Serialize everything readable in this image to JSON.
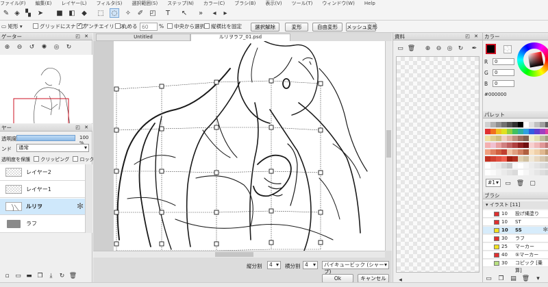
{
  "menu": [
    "ファイル(F)",
    "編集(E)",
    "レイヤー(L)",
    "フィルタ(S)",
    "選択範囲(S)",
    "ステップ(N)",
    "カラー(C)",
    "ブラシ(B)",
    "表示(V)",
    "ツール(T)",
    "ウィンドウ(W)",
    "Help"
  ],
  "options": {
    "shape_label": "矩形",
    "snap_label": "グリッドにスナップ",
    "antialias_label": "アンチエイリアス",
    "round_label": "丸める",
    "round_value": "60",
    "center_label": "中央から選択",
    "ratio_label": "縦横比を固定",
    "deselect_button": "選択解除",
    "deform_button": "変形",
    "free_deform_button": "自由変形",
    "mesh_deform_button": "メッシュ変形"
  },
  "navigator": {
    "title": "ゲーター"
  },
  "layers_panel": {
    "title": "ヤー",
    "opacity_label": "透明度",
    "opacity_value": "100 %",
    "opacity_fraction": 1.0,
    "blend_label": "ンド",
    "blend_value": "通常",
    "protect_label": "透明度を保護",
    "clipping_label": "クリッピング",
    "lock_label": "ロック",
    "layers": [
      {
        "name": "レイヤー2",
        "selected": false,
        "type": "raster"
      },
      {
        "name": "レイヤー1",
        "selected": false,
        "type": "raster"
      },
      {
        "name": "ルリヲ",
        "selected": true,
        "type": "raster"
      },
      {
        "name": "ラフ",
        "selected": false,
        "type": "folder"
      }
    ]
  },
  "tabs": [
    {
      "label": "Untitled",
      "active": false
    },
    {
      "label": "ルリヲラフ_01.psd",
      "active": true
    }
  ],
  "mesh_controls": {
    "vdiv_label": "縦分割",
    "vdiv_value": "4",
    "hdiv_label": "横分割",
    "hdiv_value": "4",
    "interp_value": "バイキュービック (シャープ)",
    "ok_button": "Ok",
    "cancel_button": "キャンセル"
  },
  "material_panel": {
    "title": "資料"
  },
  "color_panel": {
    "title": "カラー",
    "r_label": "R",
    "r_value": "0",
    "g_label": "G",
    "g_value": "0",
    "b_label": "B",
    "b_value": "0",
    "hex_value": "#000000",
    "fg_color": "#000000",
    "accent": "#cc1122"
  },
  "palette_panel": {
    "title": "パレット",
    "palette_select": "#1"
  },
  "brush_panel": {
    "title": "ブラシ",
    "group_label": "イラスト [11]",
    "brushes": [
      {
        "size": "10",
        "name": "投げ縄塗り",
        "color": "#e03030",
        "selected": false
      },
      {
        "size": "10",
        "name": "ST",
        "color": "#e03030",
        "selected": false
      },
      {
        "size": "10",
        "name": "SS",
        "color": "#f0e020",
        "selected": true
      },
      {
        "size": "30",
        "name": "ラフ",
        "color": "#e03030",
        "selected": false
      },
      {
        "size": "25",
        "name": "マーカー",
        "color": "#f0e020",
        "selected": false
      },
      {
        "size": "40",
        "name": "⑤マーカー",
        "color": "#e03030",
        "selected": false
      },
      {
        "size": "30",
        "name": "コピック [乗算]",
        "color": "#b8e080",
        "selected": false
      }
    ]
  }
}
